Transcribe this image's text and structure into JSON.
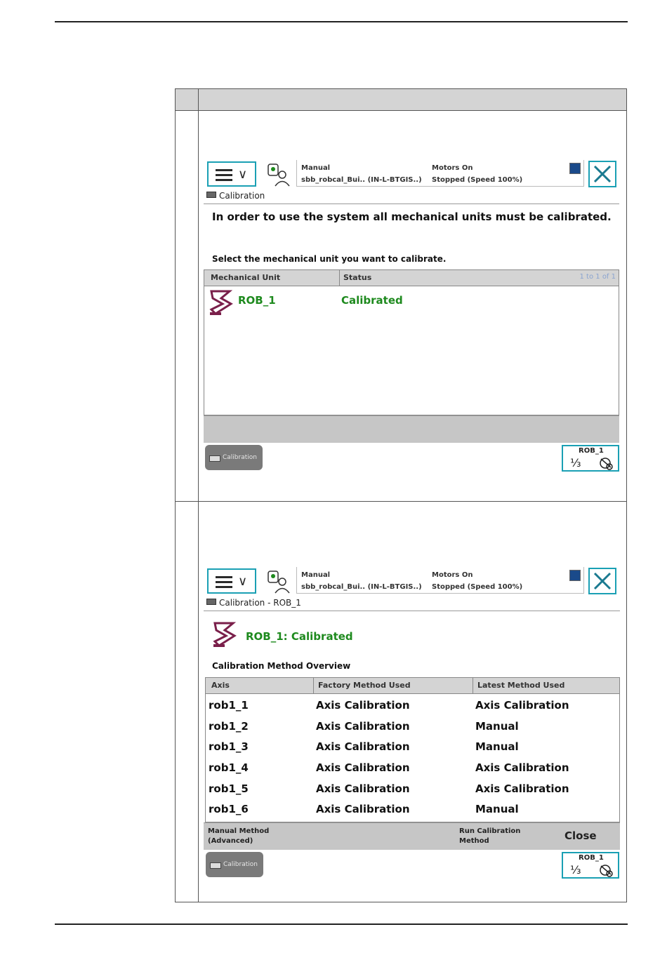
{
  "screen1": {
    "menu_chevron": "∨",
    "status": {
      "mode": "Manual",
      "system": "sbb_robcal_Bui.. (IN-L-BTGIS..)",
      "motors": "Motors On",
      "state": "Stopped (Speed 100%)"
    },
    "app_title": "Calibration",
    "message": "In order to use the system all mechanical units must be calibrated.",
    "instruction": "Select the mechanical unit you want to calibrate.",
    "table": {
      "headers": [
        "Mechanical Unit",
        "Status"
      ],
      "paging": "1 to 1 of 1",
      "rows": [
        {
          "unit": "ROB_1",
          "status": "Calibrated"
        }
      ]
    },
    "taskbar": {
      "task_label": "Calibration",
      "rob_label": "ROB_1",
      "rob_increment": "⅓"
    }
  },
  "screen2": {
    "menu_chevron": "∨",
    "status": {
      "mode": "Manual",
      "system": "sbb_robcal_Bui.. (IN-L-BTGIS..)",
      "motors": "Motors On",
      "state": "Stopped (Speed 100%)"
    },
    "app_title": "Calibration - ROB_1",
    "heading": "ROB_1:  Calibrated",
    "overview_label": "Calibration Method Overview",
    "table": {
      "headers": [
        "Axis",
        "Factory Method Used",
        "Latest Method Used"
      ],
      "rows": [
        {
          "axis": "rob1_1",
          "factory": "Axis Calibration",
          "latest": "Axis Calibration"
        },
        {
          "axis": "rob1_2",
          "factory": "Axis Calibration",
          "latest": "Manual"
        },
        {
          "axis": "rob1_3",
          "factory": "Axis Calibration",
          "latest": "Manual"
        },
        {
          "axis": "rob1_4",
          "factory": "Axis Calibration",
          "latest": "Axis Calibration"
        },
        {
          "axis": "rob1_5",
          "factory": "Axis Calibration",
          "latest": "Axis Calibration"
        },
        {
          "axis": "rob1_6",
          "factory": "Axis Calibration",
          "latest": "Manual"
        }
      ]
    },
    "commands": {
      "manual_method_line1": "Manual Method",
      "manual_method_line2": "(Advanced)",
      "run_calibration_line1": "Run Calibration",
      "run_calibration_line2": "Method",
      "close": "Close"
    },
    "taskbar": {
      "task_label": "Calibration",
      "rob_label": "ROB_1",
      "rob_increment": "⅓"
    }
  },
  "colors": {
    "accent": "#1aa0b4",
    "status_green": "#1e8a1e",
    "robot_icon": "#7a1f4a",
    "header_grey": "#d4d4d4",
    "command_bar": "#c6c6c6"
  }
}
